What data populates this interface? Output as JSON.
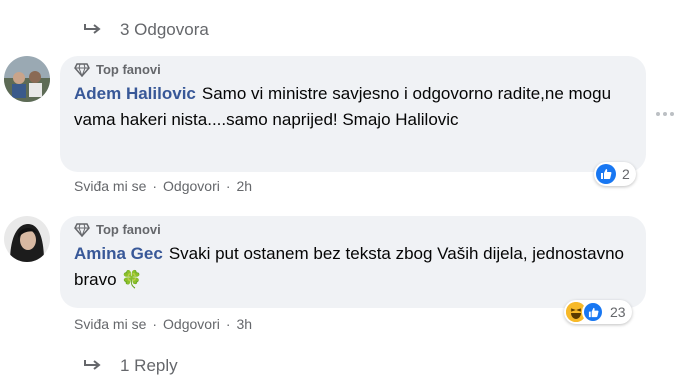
{
  "thread": {
    "replies_top_label": "3 Odgovora",
    "replies_bottom_label": "1 Reply"
  },
  "comments": [
    {
      "badge": "Top fanovi",
      "author": "Adem Halilovic",
      "text": "Samo vi ministre savjesno i odgovorno radite,ne mogu vama hakeri nista....samo naprijed! Smajo Halilovic",
      "like": "Sviđa mi se",
      "reply": "Odgovori",
      "time": "2h",
      "reaction_count": "2",
      "reaction_icons": [
        "like-icon"
      ]
    },
    {
      "badge": "Top fanovi",
      "author": "Amina Gec",
      "text": "Svaki put ostanem bez teksta zbog Vaših dijela, jednostavno bravo",
      "emoji": "🍀",
      "like": "Sviđa mi se",
      "reply": "Odgovori",
      "time": "3h",
      "reaction_count": "23",
      "reaction_icons": [
        "haha-icon",
        "like-icon"
      ]
    }
  ],
  "colors": {
    "author": "#385898",
    "meta": "#65676b",
    "bubble": "#f0f2f5",
    "like_blue": "#1877f2"
  }
}
